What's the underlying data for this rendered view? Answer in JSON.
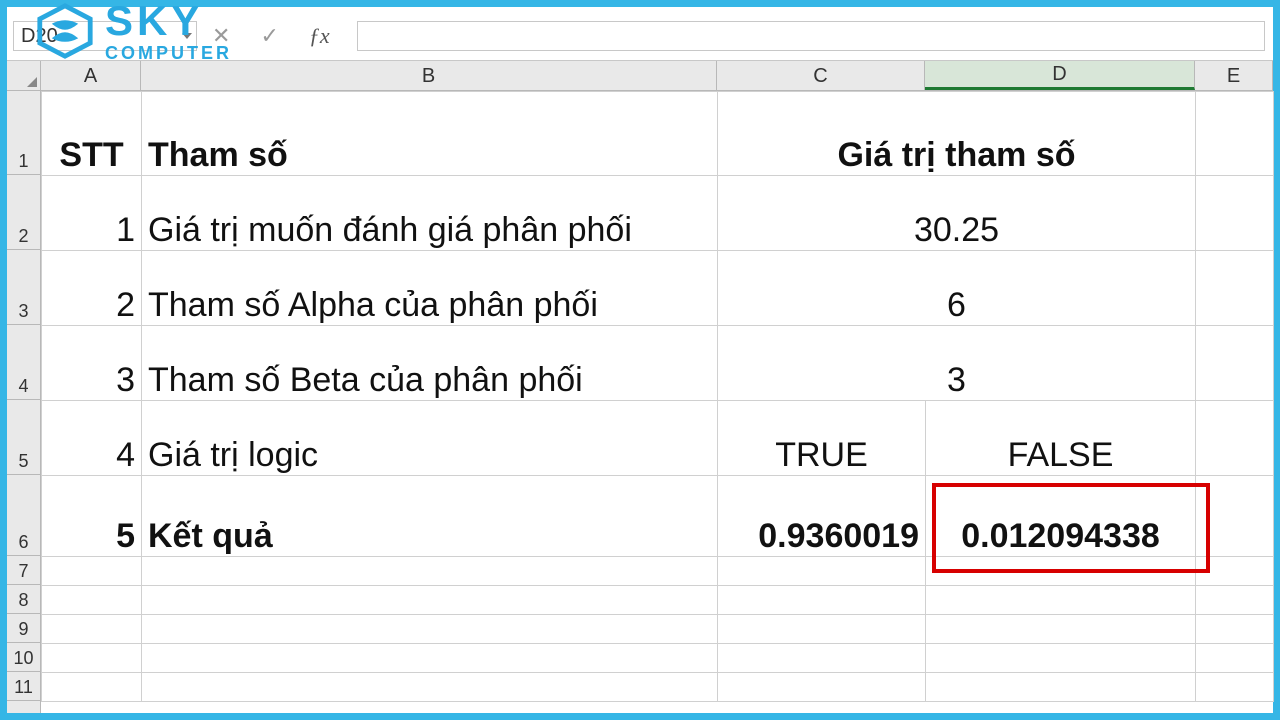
{
  "namebox": {
    "value": "D20"
  },
  "columns": {
    "A": "A",
    "B": "B",
    "C": "C",
    "D": "D",
    "E": "E"
  },
  "row_labels": [
    "1",
    "2",
    "3",
    "4",
    "5",
    "6",
    "7",
    "8",
    "9",
    "10",
    "11"
  ],
  "headers": {
    "stt": "STT",
    "tham_so": "Tham số",
    "gia_tri": "Giá trị tham số"
  },
  "rows": [
    {
      "stt": "1",
      "label": "Giá trị muốn đánh giá phân phối",
      "cd": "30.25"
    },
    {
      "stt": "2",
      "label": "Tham số Alpha của phân phối",
      "cd": "6"
    },
    {
      "stt": "3",
      "label": "Tham số Beta của phân phối",
      "cd": "3"
    },
    {
      "stt": "4",
      "label": "Giá trị logic",
      "c": "TRUE",
      "d": "FALSE"
    },
    {
      "stt": "5",
      "label": "Kết quả",
      "c": "0.9360019",
      "d": "0.012094338",
      "bold": true
    }
  ],
  "logo": {
    "main": "SKY",
    "sub": "COMPUTER"
  },
  "chart_data": {
    "type": "table",
    "title": "Tham số / Giá trị tham số",
    "columns": [
      "STT",
      "Tham số",
      "Giá trị tham số (C)",
      "Giá trị tham số (D)"
    ],
    "rows": [
      [
        "1",
        "Giá trị muốn đánh giá phân phối",
        30.25,
        null
      ],
      [
        "2",
        "Tham số Alpha của phân phối",
        6,
        null
      ],
      [
        "3",
        "Tham số Beta của phân phối",
        3,
        null
      ],
      [
        "4",
        "Giá trị logic",
        "TRUE",
        "FALSE"
      ],
      [
        "5",
        "Kết quả",
        0.9360019,
        0.012094338
      ]
    ],
    "highlight": {
      "cell": "D6",
      "value": 0.012094338
    }
  }
}
